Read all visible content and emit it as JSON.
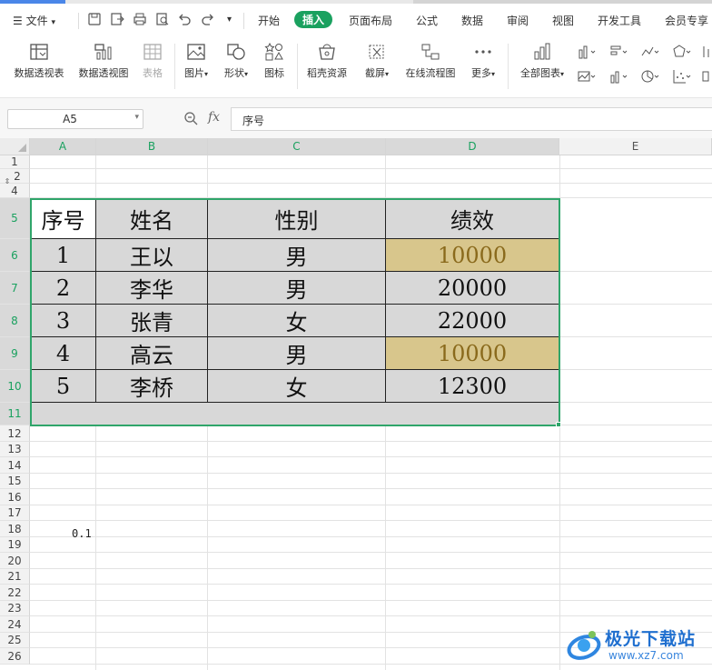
{
  "menu": {
    "file_label": "文件",
    "tabs": [
      "开始",
      "插入",
      "页面布局",
      "公式",
      "数据",
      "审阅",
      "视图",
      "开发工具",
      "会员专享"
    ],
    "active_tab": "插入"
  },
  "ribbon": {
    "buttons": [
      {
        "label": "数据透视表",
        "icon": "pivot-table-icon"
      },
      {
        "label": "数据透视图",
        "icon": "pivot-chart-icon"
      },
      {
        "label": "表格",
        "icon": "table-icon",
        "disabled": true
      },
      {
        "label": "图片",
        "icon": "picture-icon",
        "dropdown": true
      },
      {
        "label": "形状",
        "icon": "shapes-icon",
        "dropdown": true
      },
      {
        "label": "图标",
        "icon": "icons-icon"
      },
      {
        "label": "稻壳资源",
        "icon": "docer-resource-icon"
      },
      {
        "label": "截屏",
        "icon": "screenshot-icon",
        "dropdown": true
      },
      {
        "label": "在线流程图",
        "icon": "flowchart-icon"
      },
      {
        "label": "更多",
        "icon": "more-icon",
        "dropdown": true
      },
      {
        "label": "全部图表",
        "icon": "all-charts-icon",
        "dropdown": true
      }
    ]
  },
  "formula_bar": {
    "cell_ref": "A5",
    "fx_label": "fx",
    "content": "序号"
  },
  "sheet": {
    "columns": [
      "A",
      "B",
      "C",
      "D",
      "E"
    ],
    "rows": [
      "1",
      "2",
      "4",
      "5",
      "6",
      "7",
      "8",
      "9",
      "10",
      "11",
      "12",
      "13",
      "14",
      "15",
      "16",
      "17",
      "18",
      "19",
      "20",
      "21",
      "22",
      "23",
      "24",
      "25",
      "26"
    ],
    "table": {
      "headers": [
        "序号",
        "姓名",
        "性别",
        "绩效"
      ],
      "rows": [
        [
          "1",
          "王以",
          "男",
          "10000"
        ],
        [
          "2",
          "李华",
          "男",
          "20000"
        ],
        [
          "3",
          "张青",
          "女",
          "22000"
        ],
        [
          "4",
          "高云",
          "男",
          "10000"
        ],
        [
          "5",
          "李桥",
          "女",
          "12300"
        ]
      ]
    },
    "extra_cell_a18": "0.1"
  },
  "colors": {
    "accent": "#1aa15f",
    "selection_border": "#2fa56a",
    "highlight_fill": "#d8c68c"
  },
  "watermark": {
    "title": "极光下载站",
    "url": "www.xz7.com"
  }
}
